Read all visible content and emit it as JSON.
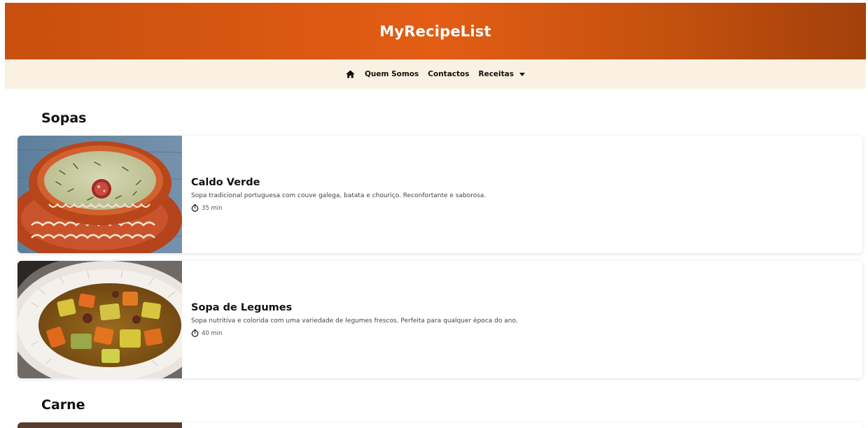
{
  "header": {
    "title": "MyRecipeList"
  },
  "nav": {
    "home_icon": "home-icon",
    "links": [
      "Quem Somos",
      "Contactos"
    ],
    "dropdown_label": "Receitas"
  },
  "sections": [
    {
      "title": "Sopas",
      "recipes": [
        {
          "title": "Caldo Verde",
          "description": "Sopa tradicional portuguesa com couve galega, batata e chouriço. Reconfortante e saborosa.",
          "time": "35 min",
          "image": "caldo-verde-photo"
        },
        {
          "title": "Sopa de Legumes",
          "description": "Sopa nutritiva e colorida com uma variedade de legumes frescos. Perfeita para qualquer época do ano.",
          "time": "40 min",
          "image": "sopa-de-legumes-photo"
        }
      ]
    },
    {
      "title": "Carne",
      "recipes": []
    }
  ],
  "colors": {
    "header_start": "#c84f0e",
    "header_end": "#a2400b",
    "nav_bg": "#fbf1e3"
  }
}
